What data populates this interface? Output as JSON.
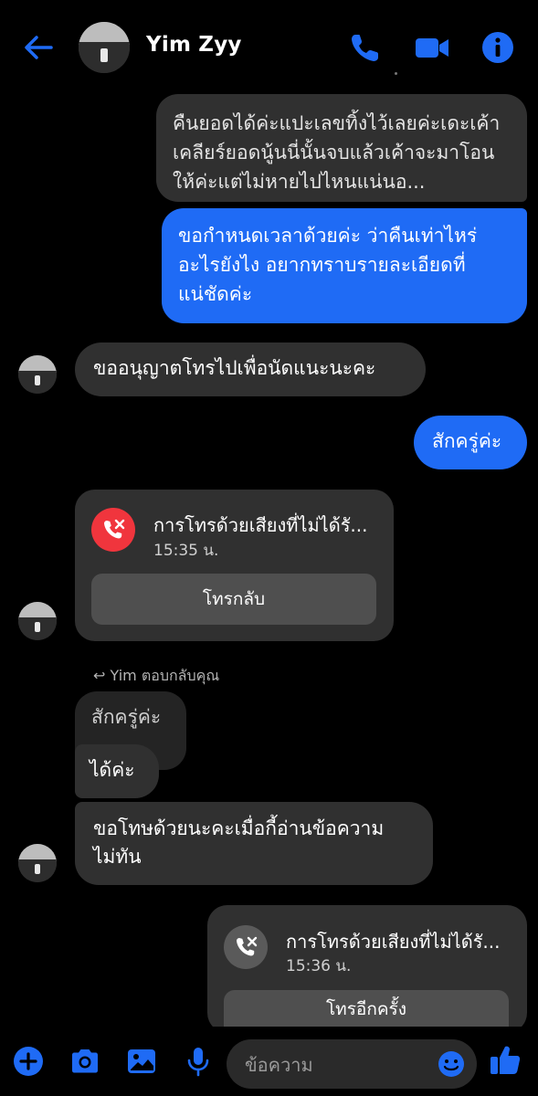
{
  "header": {
    "back_icon": "arrow-left-icon",
    "contact_name": "Yim Zyy",
    "phone_icon": "phone-icon",
    "video_icon": "video-camera-icon",
    "info_icon": "info-icon",
    "accent": "#1f6bf5"
  },
  "messages": {
    "gray_long": "คืนยอดได้ค่ะแปะเลขทิ้งไว้เลยค่ะเดะเค้า เคลียร์ยอดนู้นนี่นั้นจบแล้วเค้าจะมาโอนให้ค่ะแต่ไม่หายไปไหนแน่นอ...",
    "blue_long": "ขอกำหนดเวลาด้วยค่ะ ว่าคืนเท่าไหร่อะไรยังไง อยากทราบรายละเอียดที่แน่ชัดค่ะ",
    "gray_permission": "ขออนุญาตโทรไปเพื่อนัดแนะนะคะ",
    "blue_wait": "สักครู่ค่ะ",
    "missed_call_1": {
      "title": "การโทรด้วยเสียงที่ไม่ได้รั...",
      "time": "15:35 น.",
      "button": "โทรกลับ",
      "icon": "missed-call-icon",
      "icon_color": "#f0353d"
    },
    "reply_note": "Yim ตอบกลับคุณ",
    "quoted": "สักครู่ค่ะ",
    "gray_ok": "ได้ค่ะ",
    "gray_sorry": "ขอโทษด้วยนะคะเมื่อกี้อ่านข้อความไม่ทัน",
    "missed_call_2": {
      "title": "การโทรด้วยเสียงที่ไม่ได้รั...",
      "time": "15:36 น.",
      "button": "โทรอีกครั้ง",
      "icon": "missed-call-icon",
      "icon_color": "#5a5a5a"
    }
  },
  "composer": {
    "placeholder": "ข้อความ",
    "icons": [
      "plus-icon",
      "camera-icon",
      "image-icon",
      "microphone-icon",
      "emoji-icon",
      "thumbs-up-icon"
    ]
  }
}
